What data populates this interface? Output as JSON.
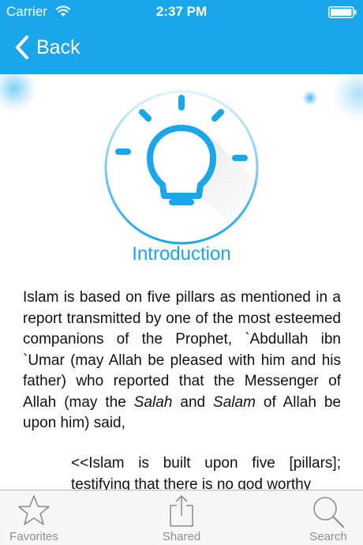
{
  "status_bar": {
    "carrier": "Carrier",
    "time": "2:37 PM",
    "wifi_icon": "wifi-icon",
    "battery_icon": "battery-icon"
  },
  "nav": {
    "back_label": "Back",
    "back_icon": "chevron-left-icon"
  },
  "header_emblem_icon": "lightbulb-icon",
  "section": {
    "title": "Introduction",
    "paragraph_parts": [
      "Islam is based on five pillars as mentioned in a report transmitted by one of the most esteemed companions of the Prophet, `Abdullah ibn `Umar (may Allah be pleased with him and his father) who reported that the Messenger of Allah (may the ",
      "Salah",
      " and ",
      "Salam",
      " of Allah be upon him) said,"
    ],
    "quote": "<<Islam is built upon five [pillars]; testifying that there is no god worthy"
  },
  "tab_bar": {
    "tabs": [
      {
        "label": "Favorites",
        "icon": "star-icon"
      },
      {
        "label": "Shared",
        "icon": "share-icon"
      },
      {
        "label": "Search",
        "icon": "magnifier-icon"
      }
    ]
  },
  "colors": {
    "accent": "#1aa6ea",
    "tab_inactive": "#8e8e93",
    "tab_bar_bg": "#f7f7f7",
    "text": "#111111"
  }
}
